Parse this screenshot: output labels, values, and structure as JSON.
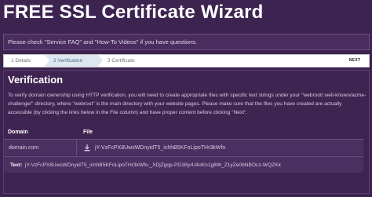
{
  "title": "FREE SSL Certificate Wizard",
  "notice": "Please check \"Service FAQ\" and \"How-To Videos\" if you have questions.",
  "steps": [
    {
      "label": "1  Details"
    },
    {
      "label": "2  Verification"
    },
    {
      "label": "3  Certificate"
    }
  ],
  "next_label": "NEXT",
  "panel": {
    "heading": "Verification",
    "text": "To verify domain ownership using HTTP verification, you will need to create appropriate files with specific text strings under your \"webroot/.well-known/acme-challenge/\" directory, where \"webroot\" is the main directory with your website pages. Please make sure that the files you have created are actually accessible (by clicking the links below in the File column) and have proper content before clicking \"Next\"."
  },
  "table": {
    "headers": {
      "domain": "Domain",
      "file": "File"
    },
    "rows": [
      {
        "domain": "domain.com",
        "file": "jY-VzFcPX8UwsWDnyidT5_ichhB5KFoLipoTHr3kWfo"
      }
    ],
    "text_label": "Text:",
    "text_value": "jY-VzFcPX8UwsWDnyidT5_ichhB5KFoLipoTHr3kWfo._XDjZgqp-PD1ByrU4oKn1g8W_Z1yZe0bNBOcz-WQZKk"
  },
  "colors": {
    "background": "#3d2350",
    "panel": "#3f2452",
    "row": "#4c2f61",
    "active_step": "#dde7f0"
  },
  "icons": {
    "file": "download-icon"
  }
}
